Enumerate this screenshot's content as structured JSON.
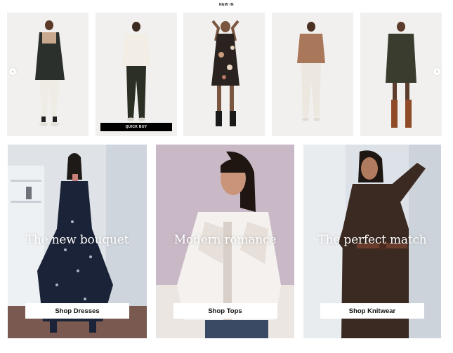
{
  "section_title": "NEW IN",
  "carousel": {
    "prev_icon": "‹",
    "next_icon": "›",
    "products": [
      {
        "colors": {
          "top": "#2c302c",
          "bottom": "#efece6",
          "skin": "#5b3a29"
        }
      },
      {
        "colors": {
          "top": "#f2eee5",
          "bottom": "#2b2f24",
          "skin": "#3d2a20"
        },
        "quick_buy": "QUICK BUY"
      },
      {
        "colors": {
          "top": "#2a2320",
          "bottom": "#2a2320",
          "skin": "#7a5540"
        }
      },
      {
        "colors": {
          "top": "#a9775a",
          "bottom": "#ede8df",
          "skin": "#4a3124"
        }
      },
      {
        "colors": {
          "top": "#3a3d2e",
          "bottom": "#8f4b28",
          "skin": "#5c3d2d"
        }
      }
    ]
  },
  "banners": [
    {
      "heading": "The new bouquet",
      "button": "Shop Dresses",
      "bg": "#dfe3e8",
      "garment": "#1b2338"
    },
    {
      "heading": "Modern romance",
      "button": "Shop Tops",
      "bg": "#c9b9c7",
      "garment": "#f4f1ee"
    },
    {
      "heading": "The perfect match",
      "button": "Shop Knitwear",
      "bg": "#dde2e8",
      "garment": "#3b2a22"
    }
  ]
}
